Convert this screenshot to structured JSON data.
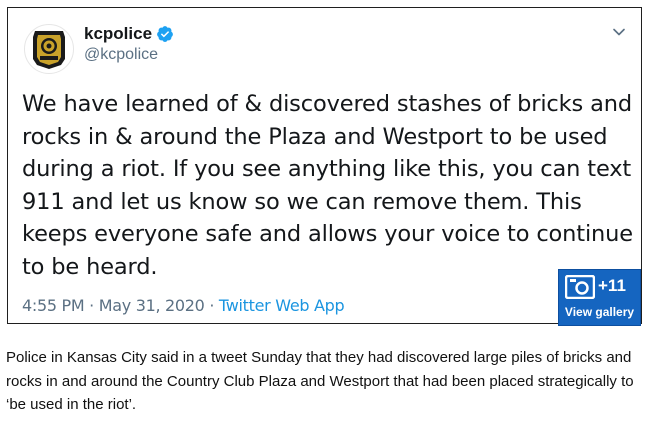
{
  "tweet": {
    "display_name": "kcpolice",
    "handle": "@kcpolice",
    "verified_icon": "verified-badge-icon",
    "avatar_icon": "police-badge-logo",
    "text": "We have learned of & discovered stashes of bricks and rocks in & around the Plaza and Westport to be used during a riot. If you see anything like this, you can text 911 and let us know so we can remove them. This keeps everyone safe and allows your voice to continue to be heard.",
    "time": "4:55 PM",
    "separator": " · ",
    "date": "May 31, 2020",
    "source": "Twitter Web App",
    "menu_icon": "chevron-down-icon"
  },
  "gallery": {
    "count": "+11",
    "label": "View gallery",
    "icon": "camera-icon",
    "color": "#1565c0"
  },
  "caption": "Police in Kansas City said in a tweet Sunday that they had discovered large piles of bricks and rocks in and around the Country Club Plaza and Westport that had been placed strategically to ‘be used in the riot’.",
  "colors": {
    "name": "#14171a",
    "muted": "#5b7083",
    "link": "#1b95e0",
    "verified": "#1da1f2"
  }
}
